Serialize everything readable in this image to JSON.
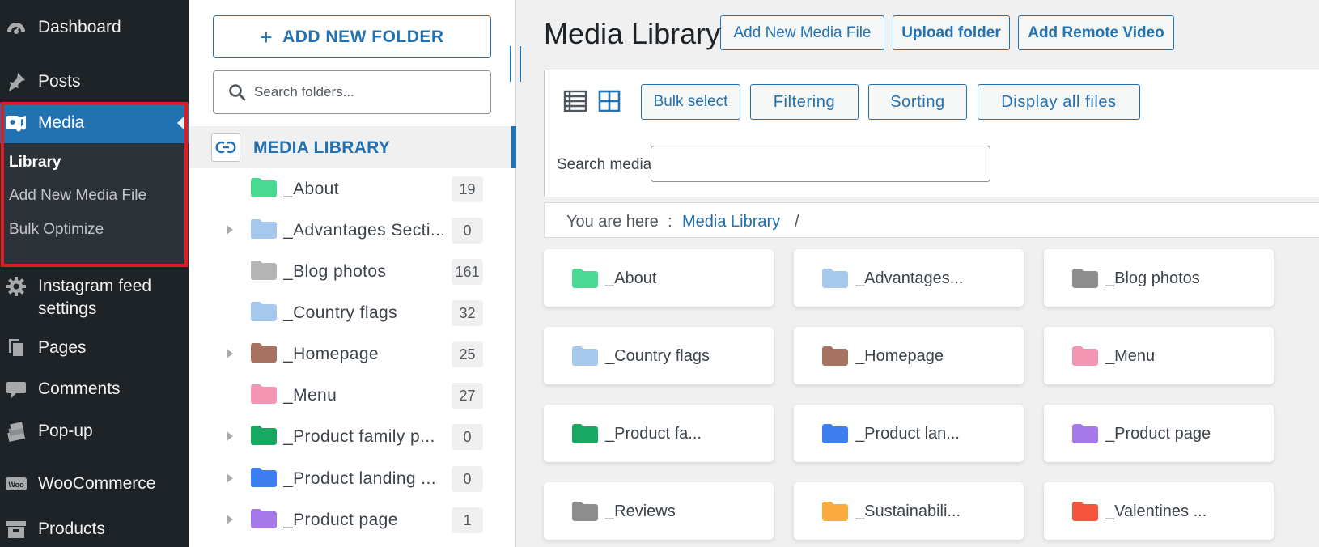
{
  "sidebar": {
    "items": [
      {
        "label": "Dashboard",
        "icon": "dashboard-icon"
      },
      {
        "label": "Posts",
        "icon": "pin-icon"
      },
      {
        "label": "Media",
        "icon": "media-icon"
      },
      {
        "label": "Instagram feed settings",
        "icon": "gear-icon"
      },
      {
        "label": "Pages",
        "icon": "pages-icon"
      },
      {
        "label": "Comments",
        "icon": "comment-icon"
      },
      {
        "label": "Pop-up",
        "icon": "popup-icon"
      },
      {
        "label": "WooCommerce",
        "icon": "woocommerce-icon"
      },
      {
        "label": "Products",
        "icon": "products-icon"
      }
    ],
    "instagram_line1": "Instagram feed",
    "instagram_line2": "settings",
    "media_submenu": [
      "Library",
      "Add New Media File",
      "Bulk Optimize"
    ],
    "highlight_color": "#e11b22"
  },
  "folder_panel": {
    "add_folder_label": "ADD NEW FOLDER",
    "search_placeholder": "Search folders...",
    "root_label": "MEDIA LIBRARY",
    "folders": [
      {
        "name": "_About",
        "count": "19",
        "color": "#4ad991",
        "expandable": false
      },
      {
        "name": "_Advantages Secti...",
        "count": "0",
        "color": "#a6c8ec",
        "expandable": true
      },
      {
        "name": "_Blog photos",
        "count": "161",
        "color": "#b4b4b4",
        "expandable": false
      },
      {
        "name": "_Country flags",
        "count": "32",
        "color": "#a6c8ec",
        "expandable": false
      },
      {
        "name": "_Homepage",
        "count": "25",
        "color": "#a87262",
        "expandable": true
      },
      {
        "name": "_Menu",
        "count": "27",
        "color": "#f495b4",
        "expandable": false
      },
      {
        "name": "_Product family p...",
        "count": "0",
        "color": "#17a862",
        "expandable": true
      },
      {
        "name": "_Product landing ...",
        "count": "0",
        "color": "#3d7ef0",
        "expandable": true
      },
      {
        "name": "_Product page",
        "count": "1",
        "color": "#a679e8",
        "expandable": true
      }
    ]
  },
  "main": {
    "title": "Media Library",
    "actions": [
      "Add New Media File",
      "Upload folder",
      "Add Remote Video"
    ],
    "toolbar": {
      "bulk_select": "Bulk select",
      "filtering": "Filtering",
      "sorting": "Sorting",
      "display_all": "Display all files",
      "search_label": "Search media"
    },
    "breadcrumb": {
      "prefix": "You are here",
      "separator": ":",
      "link": "Media Library",
      "trail": "/"
    },
    "cards": [
      {
        "name": "_About",
        "color": "#4ad991"
      },
      {
        "name": "_Advantages...",
        "color": "#a6c8ec"
      },
      {
        "name": "_Blog photos",
        "color": "#8e8e8e"
      },
      {
        "name": "_Country flags",
        "color": "#a6c8ec"
      },
      {
        "name": "_Homepage",
        "color": "#a87262"
      },
      {
        "name": "_Menu",
        "color": "#f495b4"
      },
      {
        "name": "_Product fa...",
        "color": "#17a862"
      },
      {
        "name": "_Product lan...",
        "color": "#3d7ef0"
      },
      {
        "name": "_Product page",
        "color": "#a679e8"
      },
      {
        "name": "_Reviews",
        "color": "#8e8e8e"
      },
      {
        "name": "_Sustainabili...",
        "color": "#fbac3f"
      },
      {
        "name": "_Valentines ...",
        "color": "#f5553c"
      }
    ]
  }
}
